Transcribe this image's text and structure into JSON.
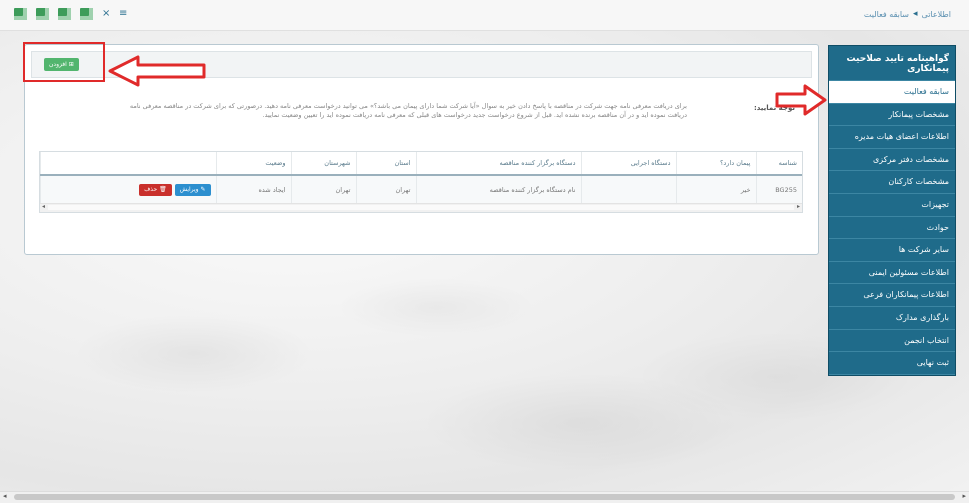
{
  "breadcrumb": {
    "root": "اطلاعاتی",
    "separator": "◂",
    "current": "سابقه فعالیت"
  },
  "toolbar": {
    "icons": [
      "grid-green-icon",
      "grid-green-icon",
      "grid-green-icon",
      "grid-green-icon",
      "x-small-icon",
      "list-icon"
    ]
  },
  "sidebar": {
    "title": "گواهینامه تایید صلاحیت پیمانکاری",
    "items": [
      {
        "label": "سابقه فعالیت",
        "active": true
      },
      {
        "label": "مشخصات پیمانکار",
        "active": false
      },
      {
        "label": "اطلاعات اعضای هیات مدیره",
        "active": false
      },
      {
        "label": "مشخصات دفتر مرکزی",
        "active": false
      },
      {
        "label": "مشخصات کارکنان",
        "active": false
      },
      {
        "label": "تجهیزات",
        "active": false
      },
      {
        "label": "حوادث",
        "active": false
      },
      {
        "label": "سایر شرکت ها",
        "active": false
      },
      {
        "label": "اطلاعات مسئولین ایمنی",
        "active": false
      },
      {
        "label": "اطلاعات پیمانکاران فرعی",
        "active": false
      },
      {
        "label": "بارگذاری مدارک",
        "active": false
      },
      {
        "label": "انتخاب انجمن",
        "active": false
      },
      {
        "label": "ثبت نهایی",
        "active": false
      }
    ]
  },
  "main": {
    "new_button": "افزودن",
    "note_label": "توجه نمایید:",
    "note_text": "برای دریافت معرفی نامه جهت شرکت در مناقصه با پاسخ دادن خیر به سوال «آیا شرکت شما دارای پیمان می باشد؟» می توانید درخواست معرفی نامه دهید. درصورتی که برای شرکت در مناقصه معرفی نامه دریافت نموده اید و در آن مناقصه برنده نشده اید. قبل از شروع درخواست جدید درخواست های قبلی که معرفی نامه دریافت نموده اید را تعیین وضعیت نمایید.",
    "table": {
      "headers": [
        "شناسه",
        "پیمان دارد؟",
        "دستگاه اجرایی",
        "دستگاه برگزار کننده مناقصه",
        "استان",
        "شهرستان",
        "وضعیت",
        ""
      ],
      "rows": [
        {
          "id": "BG255",
          "has_contract": "خیر",
          "exec_org": "",
          "org_name": "نام دستگاه برگزار کننده مناقصه",
          "province": "تهران",
          "city": "تهران",
          "status": "ایجاد شده",
          "edit_label": "ویرایش",
          "delete_label": "حذف"
        }
      ]
    }
  },
  "colors": {
    "sidebar_bg": "#1f6b8a",
    "highlight": "#e02a2a",
    "new_button": "#52b56e",
    "delete_button": "#c9302c",
    "edit_button": "#2c8fcf"
  }
}
